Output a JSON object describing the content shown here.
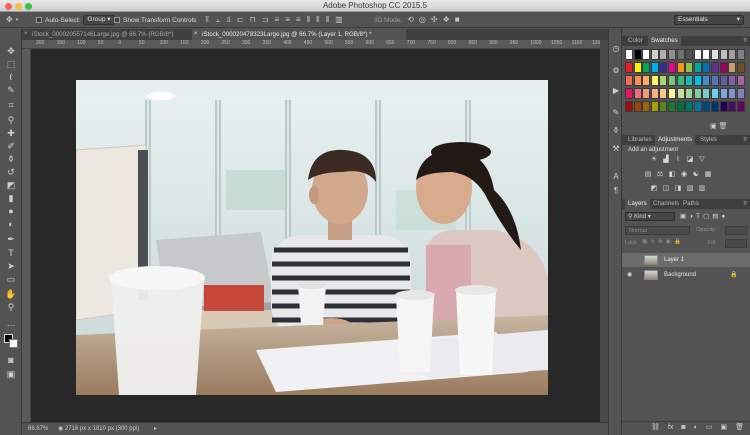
{
  "app": {
    "title": "Adobe Photoshop CC 2015.5"
  },
  "options_bar": {
    "auto_select_label": "Auto-Select:",
    "auto_select_value": "Group",
    "show_transform_label": "Show Transform Controls",
    "mode_3d_label": "3D Mode:",
    "workspace_value": "Essentials"
  },
  "tabs": [
    {
      "label": "iStock_000020557146Large.jpg @ 66.7% (RGB/8*)",
      "active": false
    },
    {
      "label": "iStock_000020478323Large.jpg @ 66.7% (Layer 1, RGB/8*) *",
      "active": true
    }
  ],
  "ruler": {
    "ticks": [
      "200",
      "150",
      "100",
      "50",
      "0",
      "50",
      "100",
      "150",
      "200",
      "250",
      "300",
      "350",
      "400",
      "450",
      "500",
      "550",
      "600",
      "650",
      "700",
      "750",
      "800",
      "850",
      "900",
      "950",
      "1000",
      "1050",
      "1100",
      "1150"
    ]
  },
  "status": {
    "zoom": "66.67%",
    "doc_info": "2716 px x 1810 px (300 ppi)"
  },
  "panels": {
    "color_tab": "Color",
    "swatches_tab": "Swatches",
    "libraries_tab": "Libraries",
    "adjustments_tab": "Adjustments",
    "styles_tab": "Styles",
    "add_adjustment": "Add an adjustment",
    "layers_tab": "Layers",
    "channels_tab": "Channels",
    "paths_tab": "Paths",
    "kind_filter": "Kind",
    "blend_mode": "Normal",
    "opacity_label": "Opacity:",
    "lock_label": "Lock:",
    "fill_label": "Fill:",
    "layers": [
      {
        "name": "Layer 1",
        "selected": true,
        "visible": false
      },
      {
        "name": "Background",
        "selected": false,
        "visible": true,
        "locked": true
      }
    ]
  },
  "swatch_colors": [
    "#ffffff",
    "#000000",
    "#ffffff",
    "#d0d0d0",
    "#b0b0b0",
    "#909090",
    "#707070",
    "#505050",
    "#ffffff",
    "#ffffff",
    "#e0e0e0",
    "#c0c0c0",
    "#a0a0a0",
    "#808080",
    "#ed1c24",
    "#fff200",
    "#00a651",
    "#00aeef",
    "#2e3192",
    "#ec008c",
    "#f7941d",
    "#8dc63f",
    "#00a99d",
    "#0072bc",
    "#662d91",
    "#9e005d",
    "#c69c6d",
    "#754c24",
    "#f26c4f",
    "#f68e56",
    "#fbaf5d",
    "#fff568",
    "#acd373",
    "#7cc576",
    "#3bb878",
    "#1abbb4",
    "#00bff3",
    "#448ccb",
    "#5674b9",
    "#605ca8",
    "#855fa8",
    "#a763a8",
    "#ed145b",
    "#f26d7d",
    "#f69679",
    "#f9ad81",
    "#fdc689",
    "#fff799",
    "#c4df9b",
    "#a3d39c",
    "#82ca9d",
    "#7accc8",
    "#6dcff6",
    "#7da7d9",
    "#8393ca",
    "#8781bd",
    "#9e0b0f",
    "#a0410d",
    "#a3620a",
    "#aba000",
    "#598527",
    "#1a7b30",
    "#007236",
    "#00746b",
    "#0076a3",
    "#004a80",
    "#003471",
    "#21005d",
    "#440e62",
    "#630460"
  ],
  "icons": {
    "move": "move-icon",
    "marquee": "marquee-icon",
    "lasso": "lasso-icon",
    "quick_select": "quick-select-icon",
    "crop": "crop-icon",
    "eyedropper": "eyedropper-icon",
    "healing": "healing-brush-icon",
    "brush": "brush-icon",
    "stamp": "clone-stamp-icon",
    "history_brush": "history-brush-icon",
    "eraser": "eraser-icon",
    "gradient": "gradient-icon",
    "blur": "blur-icon",
    "dodge": "dodge-icon",
    "pen": "pen-icon",
    "type": "type-icon",
    "path_select": "path-selection-icon",
    "shape": "rectangle-shape-icon",
    "hand": "hand-icon",
    "zoom": "zoom-icon"
  }
}
